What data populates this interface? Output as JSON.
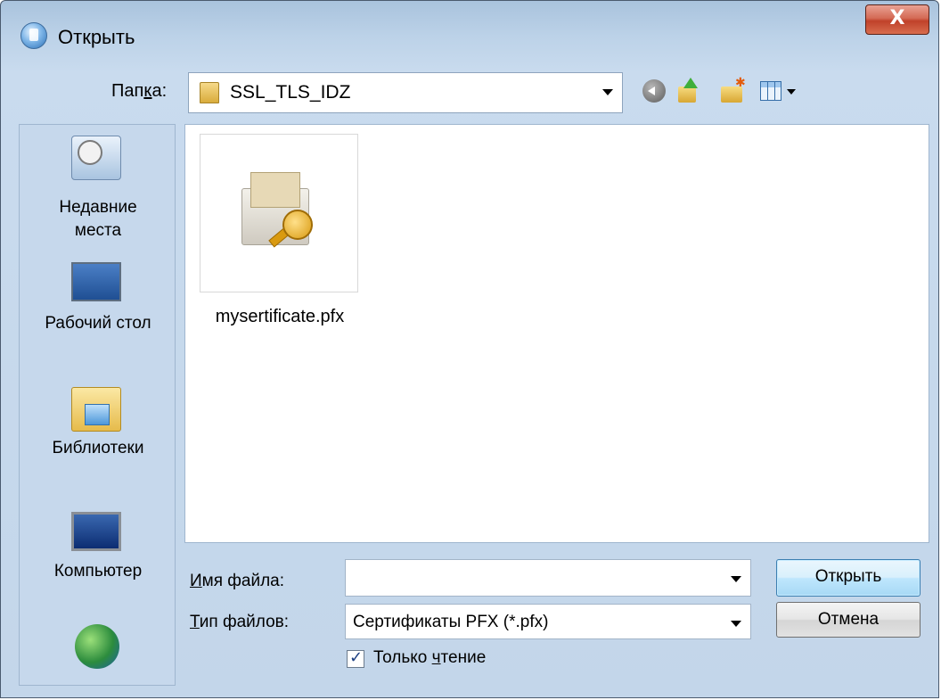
{
  "window": {
    "title": "Открыть",
    "close_label": "X"
  },
  "toolbar": {
    "folder_label_prefix": "Пап",
    "folder_label_accel": "к",
    "folder_label_suffix": "а:",
    "current_folder": "SSL_TLS_IDZ"
  },
  "places": [
    {
      "label": "Недавние места",
      "icon": "recent-places-icon"
    },
    {
      "label": "Рабочий стол",
      "icon": "desktop-icon"
    },
    {
      "label": "Библиотеки",
      "icon": "libraries-icon"
    },
    {
      "label": "Компьютер",
      "icon": "computer-icon"
    },
    {
      "label": "",
      "icon": "network-icon"
    }
  ],
  "files": [
    {
      "name": "mysertificate.pfx",
      "icon": "certificate-icon"
    }
  ],
  "form": {
    "filename_label_accel": "И",
    "filename_label_rest": "мя файла:",
    "filename_value": "",
    "filetype_label_accel": "Т",
    "filetype_label_rest": "ип файлов:",
    "filetype_value": "Сертификаты PFX (*.pfx)",
    "readonly_prefix": "Только ",
    "readonly_accel": "ч",
    "readonly_suffix": "тение",
    "readonly_checked": true,
    "open_button": "Открыть",
    "cancel_button": "Отмена"
  }
}
